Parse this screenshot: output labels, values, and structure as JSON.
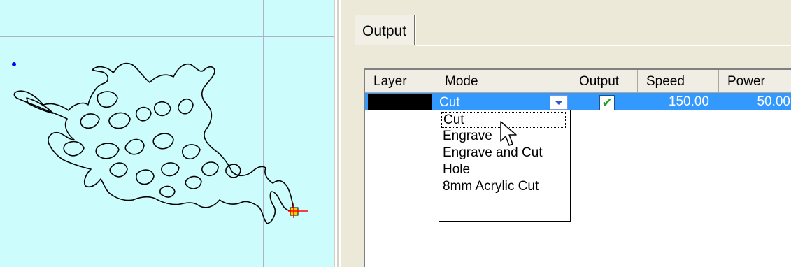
{
  "tabs": [
    {
      "label": "Output"
    }
  ],
  "layers_table": {
    "columns": [
      "Layer",
      "Mode",
      "Output",
      "Speed",
      "Power"
    ],
    "rows": [
      {
        "layer_color": "#000000",
        "mode": "Cut",
        "output": true,
        "speed": "150.00",
        "power": "50.00"
      }
    ]
  },
  "mode_dropdown": {
    "options": [
      "Cut",
      "Engrave",
      "Engrave and Cut",
      "Hole",
      "8mm Acrylic Cut"
    ],
    "selected": "Cut"
  },
  "colors": {
    "canvas_bg": "#ccfcfc",
    "grid_line": "#b0b0c8",
    "selection": "#3399ff",
    "origin_dot": "#0000ff"
  },
  "icons": {
    "output_check": "checkmark-icon",
    "dropdown_button": "chevron-down-icon",
    "cursor": "mouse-pointer-icon",
    "origin_marker": "origin-marker-icon"
  }
}
